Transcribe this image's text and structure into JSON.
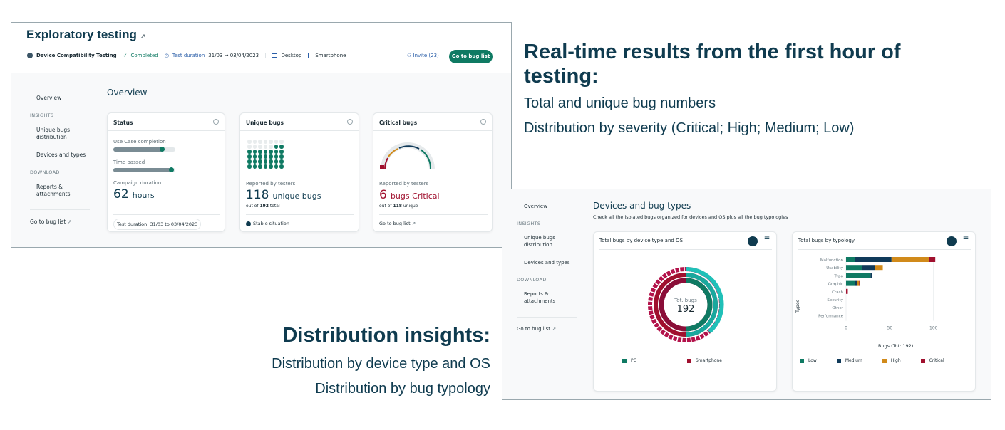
{
  "colors": {
    "brand_dark": "#0f3b4f",
    "green": "#0f7a63",
    "red": "#a0102e",
    "teal": "#20c0b8",
    "orange": "#d18a1a",
    "navy": "#103a5a",
    "crimson": "#b3124a"
  },
  "shot1": {
    "title": "Exploratory testing",
    "meta": {
      "campaign_type": "Device Compatibility Testing",
      "status": "Completed",
      "duration_label": "Test duration",
      "duration_value": "31/03 → 03/04/2023",
      "device1": "Desktop",
      "device2": "Smartphone",
      "invite": "Invite (23)",
      "go_button": "Go to bug list"
    },
    "sidebar": {
      "overview": "Overview",
      "insights_head": "INSIGHTS",
      "unique_bugs": "Unique bugs distribution",
      "devices": "Devices and types",
      "download_head": "DOWNLOAD",
      "reports": "Reports & attachments",
      "go_bug_list": "Go to bug list"
    },
    "main_title": "Overview",
    "status_card": {
      "title": "Status",
      "usecase_label": "Use Case completion",
      "usecase_progress": 0.8,
      "time_label": "Time passed",
      "time_progress": 0.95,
      "campaign_label": "Campaign duration",
      "campaign_number": "62",
      "campaign_unit": "hours",
      "footer": "Test duration: 31/03 to 03/04/2023"
    },
    "unique_card": {
      "title": "Unique bugs",
      "reported": "Reported by testers",
      "number": "118",
      "unit": "unique bugs",
      "sub_prefix": "out of",
      "sub_num": "192",
      "sub_suffix": "total",
      "footer": "Stable situation",
      "dots_on": 30,
      "dots_total": 42
    },
    "critical_card": {
      "title": "Critical bugs",
      "reported": "Reported by testers",
      "number": "6",
      "unit": "bugs Critical",
      "sub_prefix": "out of",
      "sub_num": "118",
      "sub_suffix": "unique",
      "footer": "Go to bug list"
    }
  },
  "right1": {
    "title": "Real-time results from the first hour of testing:",
    "line1": "Total and unique bug numbers",
    "line2": "Distribution by severity (Critical; High; Medium; Low)"
  },
  "shot2": {
    "sidebar": {
      "overview": "Overview",
      "insights_head": "INSIGHTS",
      "unique_bugs": "Unique bugs distribution",
      "devices": "Devices and types",
      "download_head": "DOWNLOAD",
      "reports": "Reports & attachments",
      "go_bug_list": "Go to bug list"
    },
    "title": "Devices and bug types",
    "subtitle": "Check all the isolated bugs organized for devices and OS plus all the bug typologies",
    "donut_card": {
      "title": "Total bugs by device type and OS",
      "center_label": "Tot. bugs",
      "center_value": "192",
      "legend": [
        "PC",
        "Smartphone"
      ]
    },
    "bar_card": {
      "title": "Total bugs by typology",
      "ylabel": "Types",
      "xlabel": "Bugs (Tot: 192)",
      "legend": [
        "Low",
        "Medium",
        "High",
        "Critical"
      ]
    }
  },
  "chart_data": [
    {
      "type": "bar",
      "orientation": "horizontal",
      "stacked": true,
      "title": "Total bugs by typology",
      "xlabel": "Bugs (Tot: 192)",
      "ylabel": "Types",
      "categories": [
        "Malfunction",
        "Usability",
        "Typo",
        "Graphic",
        "Crash",
        "Security",
        "Other",
        "Performance"
      ],
      "xlim": [
        0,
        110
      ],
      "xticks": [
        0,
        50,
        100
      ],
      "series": [
        {
          "name": "Low",
          "color": "#0f7a63",
          "values": [
            10,
            18,
            28,
            10,
            0,
            0,
            0,
            0
          ]
        },
        {
          "name": "Medium",
          "color": "#103a5a",
          "values": [
            42,
            15,
            2,
            3,
            0,
            0,
            0,
            0
          ]
        },
        {
          "name": "High",
          "color": "#d18a1a",
          "values": [
            43,
            9,
            0,
            2,
            0,
            0,
            0,
            0
          ]
        },
        {
          "name": "Critical",
          "color": "#a0102e",
          "values": [
            7,
            0,
            0,
            1,
            2,
            0,
            0,
            0
          ]
        }
      ]
    },
    {
      "type": "pie",
      "style": "donut",
      "title": "Total bugs by device type and OS",
      "center_text": "Tot. bugs 192",
      "categories": [
        "PC",
        "Smartphone"
      ],
      "values": [
        74,
        118
      ]
    }
  ]
}
